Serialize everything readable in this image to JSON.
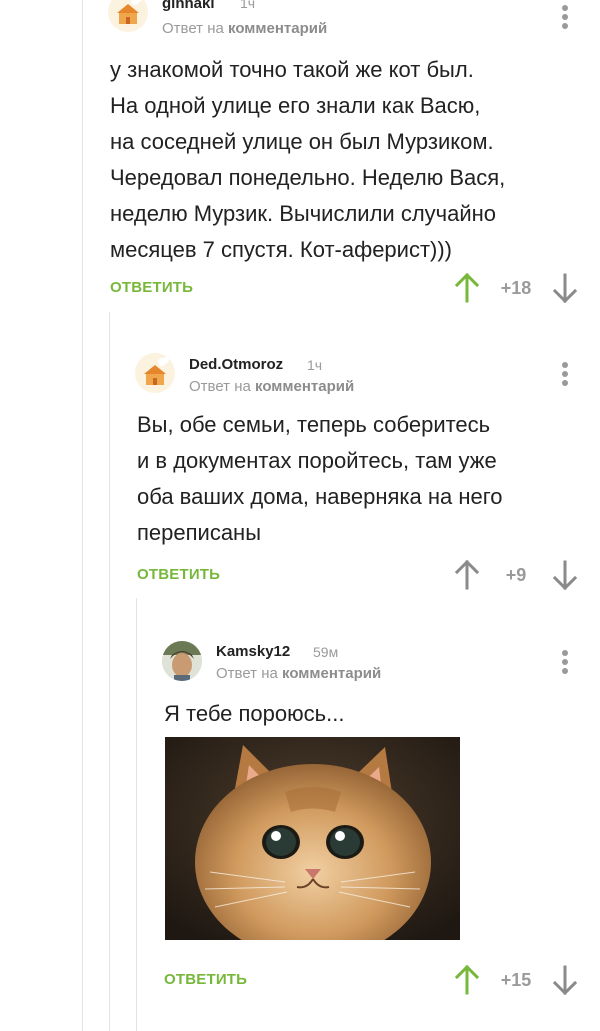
{
  "comments": [
    {
      "author": "ginnaki",
      "time": "1ч",
      "reply_prefix": "Ответ на",
      "reply_target": "комментарий",
      "lines": [
        "у знакомой точно такой же кот был.",
        "На одной улице его знали как Васю,",
        "на соседней улице он был Мурзиком.",
        "Чередовал понедельно. Неделю Вася,",
        "неделю Мурзик. Вычислили случайно",
        "месяцев 7 спустя. Кот-аферист)))"
      ],
      "reply_label": "ОТВЕТИТЬ",
      "score": "+18",
      "upvote_color": "#77b83b"
    },
    {
      "author": "Ded.Otmoroz",
      "time": "1ч",
      "reply_prefix": "Ответ на",
      "reply_target": "комментарий",
      "lines": [
        "Вы, обе семьи, теперь соберитесь",
        "и в документах поройтесь, там уже",
        "оба ваших дома, наверняка на него",
        "переписаны"
      ],
      "reply_label": "ОТВЕТИТЬ",
      "score": "+9",
      "upvote_color": "#8a8a8a"
    },
    {
      "author": "Kamsky12",
      "time": "59м",
      "reply_prefix": "Ответ на",
      "reply_target": "комментарий",
      "lines": [
        "Я тебе порoюсь..."
      ],
      "reply_label": "ОТВЕТИТЬ",
      "score": "+15",
      "upvote_color": "#77b83b"
    }
  ],
  "colors": {
    "accent": "#77b83b",
    "muted": "#9a9a9a",
    "thread_line": "#e3e3e3"
  }
}
